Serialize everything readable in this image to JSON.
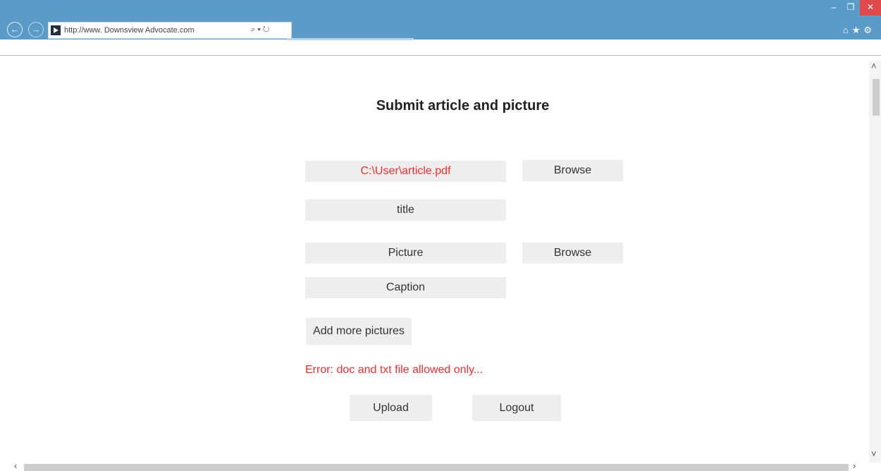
{
  "browser": {
    "url": "http://www. Downsview Advocate.com",
    "search_glyph": "⌕ ▾ ↻",
    "back_glyph": "←",
    "forward_glyph": "→",
    "minimize_glyph": "‒",
    "restore_glyph": "❐",
    "close_glyph": "✕",
    "home_glyph": "⌂",
    "star_glyph": "★",
    "gear_glyph": "⚙",
    "icons": [
      "back-icon",
      "forward-icon",
      "search-icon",
      "refresh-icon",
      "home-icon",
      "favorites-star-icon",
      "settings-gear-icon",
      "minimize-icon",
      "restore-icon",
      "close-icon"
    ]
  },
  "scroll": {
    "up": "˄",
    "down": "˅",
    "left": "‹",
    "right": "›"
  },
  "page": {
    "title": "Submit article and picture",
    "article_file": "C:\\User\\article.pdf",
    "browse1_label": "Browse",
    "title_field": "title",
    "picture_field": "Picture",
    "browse2_label": "Browse",
    "caption_field": "Caption",
    "add_more_label": "Add more pictures",
    "error_text": "Error: doc and txt file allowed only...",
    "upload_label": "Upload",
    "logout_label": "Logout"
  },
  "colors": {
    "titlebar": "#5a9bc8",
    "close_button": "#e04a4a",
    "error": "#ff2b2b",
    "field_bg": "#eeeeee"
  }
}
